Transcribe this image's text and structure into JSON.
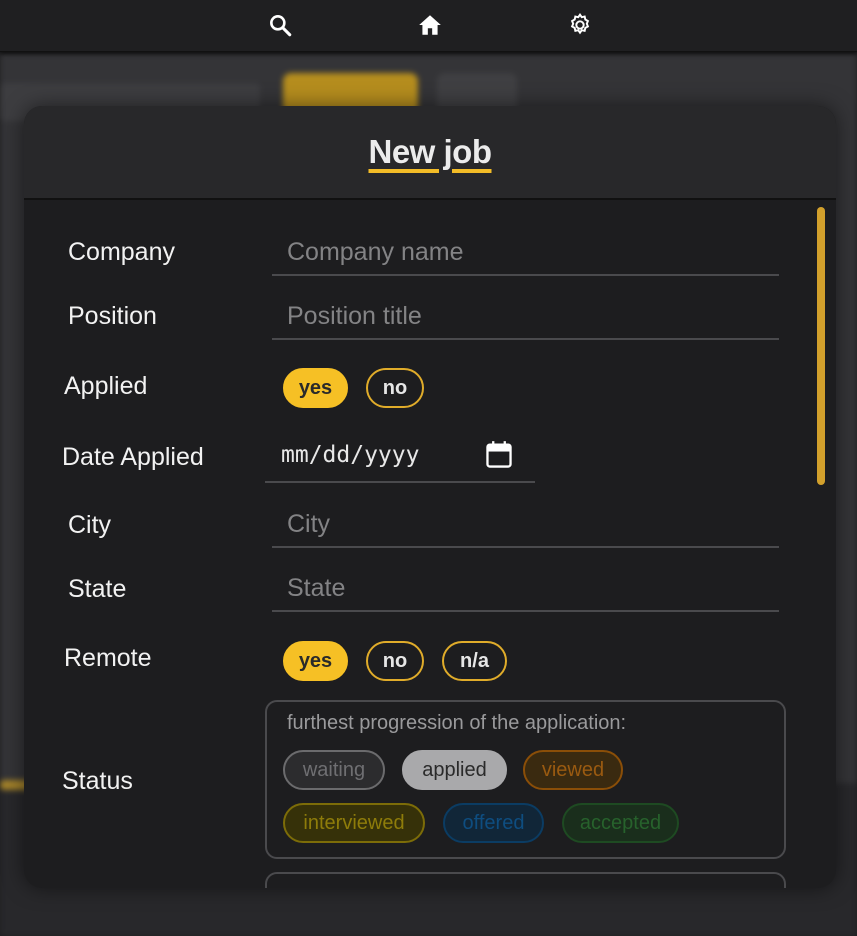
{
  "nav": {
    "icons": [
      "search-icon",
      "home-icon",
      "gear-icon"
    ]
  },
  "modal": {
    "title": "New job"
  },
  "form": {
    "company": {
      "label": "Company",
      "placeholder": "Company name",
      "value": ""
    },
    "position": {
      "label": "Position",
      "placeholder": "Position title",
      "value": ""
    },
    "applied": {
      "label": "Applied",
      "options": [
        "yes",
        "no"
      ],
      "selected": "yes"
    },
    "date_applied": {
      "label": "Date Applied",
      "value": "mm/dd/yyyy"
    },
    "city": {
      "label": "City",
      "placeholder": "City",
      "value": ""
    },
    "state": {
      "label": "State",
      "placeholder": "State",
      "value": ""
    },
    "remote": {
      "label": "Remote",
      "options": [
        "yes",
        "no",
        "n/a"
      ],
      "selected": "yes"
    },
    "status": {
      "label": "Status",
      "hint": "furthest progression of the application:",
      "options": [
        "waiting",
        "applied",
        "viewed",
        "interviewed",
        "offered",
        "accepted"
      ],
      "selected": "applied"
    }
  },
  "colors": {
    "accent": "#f6c025",
    "waiting": "#6b6b6d",
    "applied": "#a9a9ab",
    "viewed": "#8a4e08",
    "interviewed": "#7c6c08",
    "offered": "#0b3c63",
    "accepted": "#1e4a22"
  }
}
